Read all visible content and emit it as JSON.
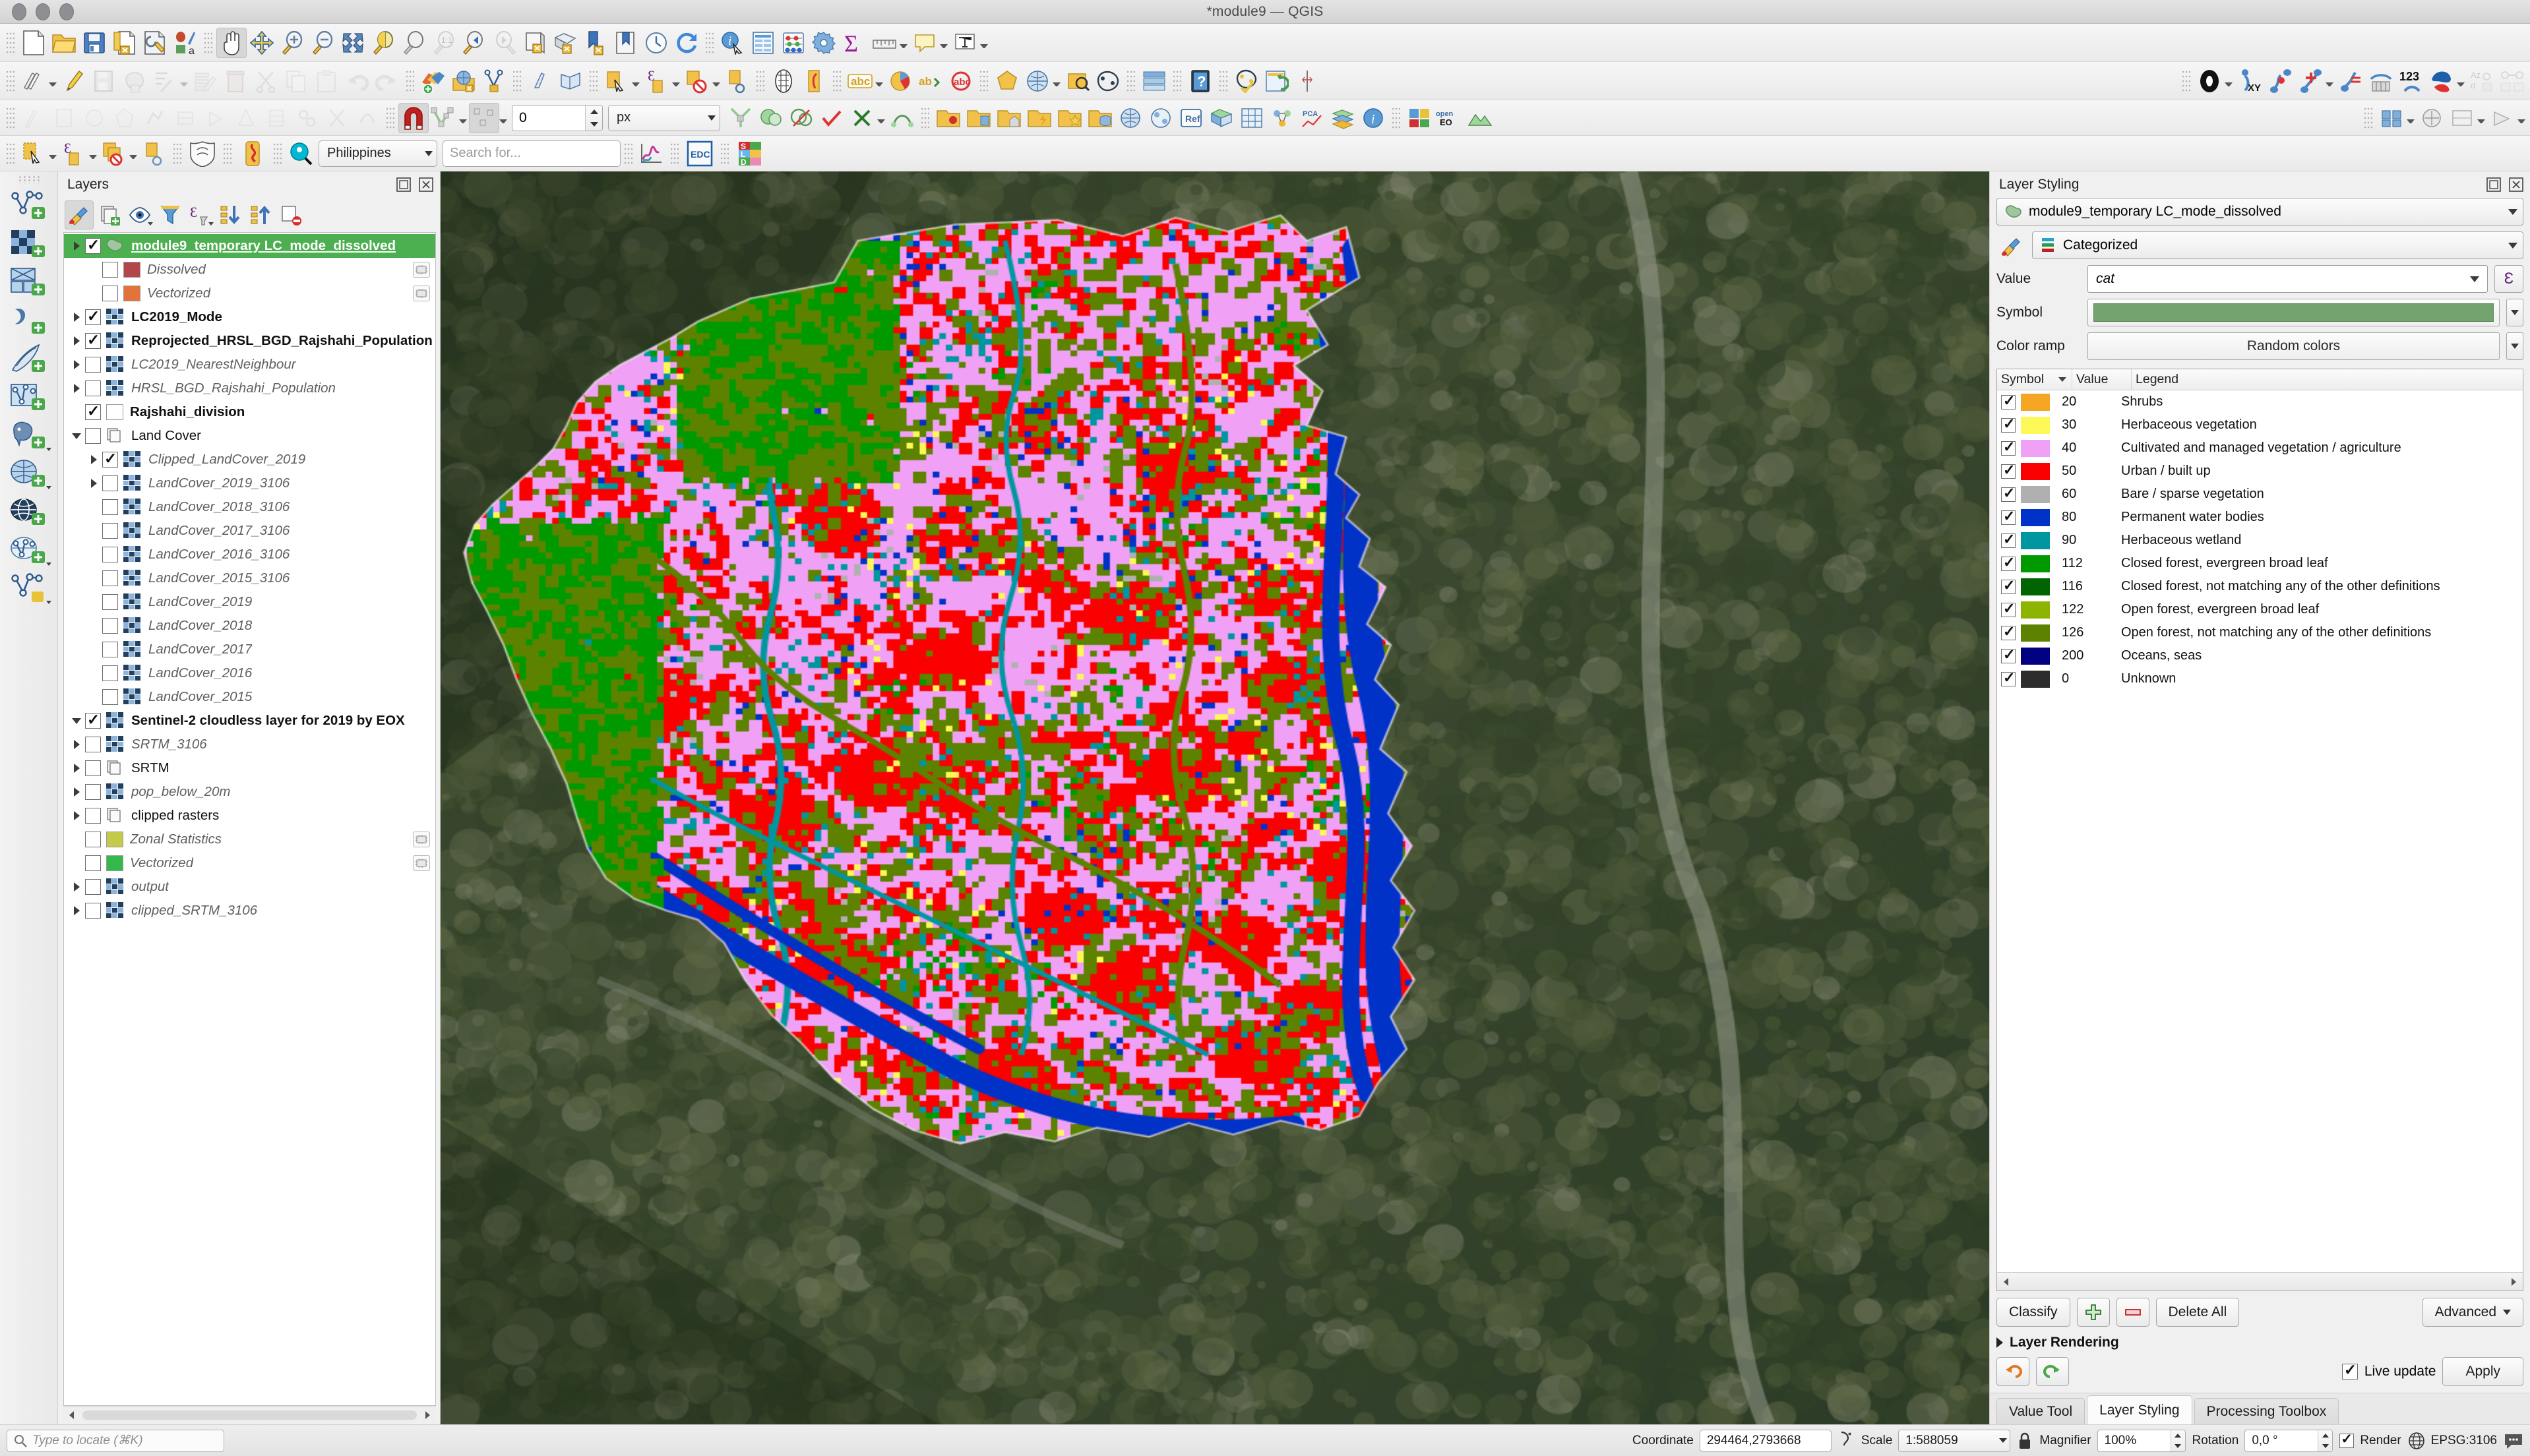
{
  "window": {
    "title": "*module9 — QGIS"
  },
  "toolbars": {
    "row1": [
      {
        "name": "new-project-icon",
        "label": "New Project"
      },
      {
        "name": "open-project-icon",
        "label": "Open Project"
      },
      {
        "name": "save-project-icon",
        "label": "Save Project"
      },
      {
        "name": "new-print-layout-icon",
        "label": "New Print Layout"
      },
      {
        "name": "style-manager-icon",
        "label": "Style Manager"
      },
      {
        "name": "pan-map-icon",
        "label": "Pan Map"
      },
      {
        "name": "pan-to-selection-icon",
        "label": "Pan Map to Selection"
      },
      {
        "name": "zoom-in-icon",
        "label": "Zoom In"
      },
      {
        "name": "zoom-out-icon",
        "label": "Zoom Out"
      },
      {
        "name": "zoom-full-icon",
        "label": "Zoom Full"
      },
      {
        "name": "zoom-selection-icon",
        "label": "Zoom to Selection"
      },
      {
        "name": "zoom-layer-icon",
        "label": "Zoom to Layer"
      },
      {
        "name": "zoom-native-icon",
        "label": "Zoom to Native Resolution"
      },
      {
        "name": "zoom-last-icon",
        "label": "Zoom Last"
      },
      {
        "name": "zoom-next-icon",
        "label": "Zoom Next"
      },
      {
        "name": "new-map-view-icon",
        "label": "New Map View"
      },
      {
        "name": "new-3d-map-view-icon",
        "label": "New 3D Map View"
      },
      {
        "name": "refresh-icon",
        "label": "Refresh"
      },
      {
        "name": "identify-features-icon",
        "label": "Identify Features"
      },
      {
        "name": "attribute-table-icon",
        "label": "Open Attribute Table"
      },
      {
        "name": "field-calculator-icon",
        "label": "Field Calculator"
      },
      {
        "name": "statistics-icon",
        "label": "Statistical Summary"
      },
      {
        "name": "measure-icon",
        "label": "Measure Line"
      },
      {
        "name": "map-tips-icon",
        "label": "Show Map Tips"
      },
      {
        "name": "new-bookmark-icon",
        "label": "New Bookmark"
      },
      {
        "name": "text-annotation-icon",
        "label": "Text Annotation"
      }
    ],
    "row4": {
      "snapping_value": "0",
      "snapping_unit": "px"
    },
    "row5": {
      "region_value": "Philippines",
      "search_placeholder": "Search for...",
      "edc_label": "EDC"
    }
  },
  "layers_panel": {
    "title": "Layers",
    "items": [
      {
        "label": "module9_temporary LC_mode_dissolved",
        "indent": 0,
        "expander": "right",
        "checked": true,
        "icon": "polygon-layer",
        "style": "sel"
      },
      {
        "label": "Dissolved",
        "indent": 1,
        "expander": "none",
        "checked": false,
        "swatch": "#b4464b",
        "style": "italic",
        "chip": true
      },
      {
        "label": "Vectorized",
        "indent": 1,
        "expander": "none",
        "checked": false,
        "swatch": "#e2733a",
        "style": "italic",
        "chip": true
      },
      {
        "label": "LC2019_Mode",
        "indent": 0,
        "expander": "right",
        "checked": true,
        "icon": "raster-layer",
        "style": "bold"
      },
      {
        "label": "Reprojected_HRSL_BGD_Rajshahi_Population",
        "indent": 0,
        "expander": "right",
        "checked": true,
        "icon": "raster-layer",
        "style": "bold"
      },
      {
        "label": "LC2019_NearestNeighbour",
        "indent": 0,
        "expander": "right",
        "checked": false,
        "icon": "raster-layer",
        "style": "italic"
      },
      {
        "label": "HRSL_BGD_Rajshahi_Population",
        "indent": 0,
        "expander": "right",
        "checked": false,
        "icon": "raster-layer",
        "style": "italic"
      },
      {
        "label": "Rajshahi_division",
        "indent": 0,
        "expander": "none",
        "checked": true,
        "swatch": "#ffffff",
        "style": "bold"
      },
      {
        "label": "Land Cover",
        "indent": 0,
        "expander": "down",
        "checked": false,
        "icon": "group",
        "style": "normal"
      },
      {
        "label": "Clipped_LandCover_2019",
        "indent": 1,
        "expander": "right",
        "checked": true,
        "icon": "raster-layer",
        "style": "italic"
      },
      {
        "label": "LandCover_2019_3106",
        "indent": 1,
        "expander": "right",
        "checked": false,
        "icon": "raster-layer",
        "style": "italic"
      },
      {
        "label": "LandCover_2018_3106",
        "indent": 1,
        "expander": "none",
        "checked": false,
        "icon": "raster-layer",
        "style": "italic"
      },
      {
        "label": "LandCover_2017_3106",
        "indent": 1,
        "expander": "none",
        "checked": false,
        "icon": "raster-layer",
        "style": "italic"
      },
      {
        "label": "LandCover_2016_3106",
        "indent": 1,
        "expander": "none",
        "checked": false,
        "icon": "raster-layer",
        "style": "italic"
      },
      {
        "label": "LandCover_2015_3106",
        "indent": 1,
        "expander": "none",
        "checked": false,
        "icon": "raster-layer",
        "style": "italic"
      },
      {
        "label": "LandCover_2019",
        "indent": 1,
        "expander": "none",
        "checked": false,
        "icon": "raster-layer",
        "style": "italic"
      },
      {
        "label": "LandCover_2018",
        "indent": 1,
        "expander": "none",
        "checked": false,
        "icon": "raster-layer",
        "style": "italic"
      },
      {
        "label": "LandCover_2017",
        "indent": 1,
        "expander": "none",
        "checked": false,
        "icon": "raster-layer",
        "style": "italic"
      },
      {
        "label": "LandCover_2016",
        "indent": 1,
        "expander": "none",
        "checked": false,
        "icon": "raster-layer",
        "style": "italic"
      },
      {
        "label": "LandCover_2015",
        "indent": 1,
        "expander": "none",
        "checked": false,
        "icon": "raster-layer",
        "style": "italic"
      },
      {
        "label": "Sentinel-2 cloudless layer for 2019 by EOX",
        "indent": 0,
        "expander": "down",
        "checked": true,
        "icon": "raster-layer",
        "style": "bold"
      },
      {
        "label": "SRTM_3106",
        "indent": 0,
        "expander": "right",
        "checked": false,
        "icon": "raster-layer",
        "style": "italic"
      },
      {
        "label": "SRTM",
        "indent": 0,
        "expander": "right",
        "checked": false,
        "icon": "group",
        "style": "normal"
      },
      {
        "label": "pop_below_20m",
        "indent": 0,
        "expander": "right",
        "checked": false,
        "icon": "raster-layer",
        "style": "italic"
      },
      {
        "label": "clipped rasters",
        "indent": 0,
        "expander": "right",
        "checked": false,
        "icon": "group",
        "style": "normal"
      },
      {
        "label": "Zonal Statistics",
        "indent": 0,
        "expander": "none",
        "checked": false,
        "swatch": "#c4ca4a",
        "style": "italic",
        "chip": true
      },
      {
        "label": "Vectorized",
        "indent": 0,
        "expander": "none",
        "checked": false,
        "swatch": "#33b84a",
        "style": "italic",
        "chip": true
      },
      {
        "label": "output",
        "indent": 0,
        "expander": "right",
        "checked": false,
        "icon": "raster-layer",
        "style": "italic"
      },
      {
        "label": "clipped_SRTM_3106",
        "indent": 0,
        "expander": "right",
        "checked": false,
        "icon": "raster-layer",
        "style": "italic"
      }
    ],
    "toolbar_icons": [
      {
        "name": "open-layer-styling-panel-icon",
        "active": true
      },
      {
        "name": "add-group-icon",
        "active": false
      },
      {
        "name": "manage-map-themes-icon",
        "active": false
      },
      {
        "name": "filter-legend-icon",
        "active": false
      },
      {
        "name": "filter-legend-by-expression-icon",
        "active": false
      },
      {
        "name": "expand-all-icon",
        "active": false
      },
      {
        "name": "collapse-all-icon",
        "active": false
      },
      {
        "name": "remove-layer-icon",
        "active": false
      }
    ]
  },
  "style_panel": {
    "title": "Layer Styling",
    "layer_name": "module9_temporary LC_mode_dissolved",
    "renderer": "Categorized",
    "value_label": "Value",
    "value_field": "cat",
    "symbol_label": "Symbol",
    "symbol_color": "#74a370",
    "colorramp_label": "Color ramp",
    "colorramp_value": "Random colors",
    "table_headers": {
      "symbol": "Symbol",
      "value": "Value",
      "legend": "Legend"
    },
    "categories": [
      {
        "color": "#f5a623",
        "value": "20",
        "legend": "Shrubs",
        "checked": true
      },
      {
        "color": "#fcf858",
        "value": "30",
        "legend": "Herbaceous vegetation",
        "checked": true
      },
      {
        "color": "#f0a0f5",
        "value": "40",
        "legend": "Cultivated and managed vegetation / agriculture",
        "checked": true
      },
      {
        "color": "#fb0000",
        "value": "50",
        "legend": "Urban / built up",
        "checked": true
      },
      {
        "color": "#b0b0b0",
        "value": "60",
        "legend": "Bare / sparse vegetation",
        "checked": true
      },
      {
        "color": "#0032c8",
        "value": "80",
        "legend": "Permanent water bodies",
        "checked": true
      },
      {
        "color": "#0096a0",
        "value": "90",
        "legend": "Herbaceous wetland",
        "checked": true
      },
      {
        "color": "#009a00",
        "value": "112",
        "legend": "Closed forest, evergreen broad leaf",
        "checked": true
      },
      {
        "color": "#006400",
        "value": "116",
        "legend": "Closed forest, not matching any of the other definitions",
        "checked": true
      },
      {
        "color": "#8db400",
        "value": "122",
        "legend": "Open forest, evergreen broad leaf",
        "checked": true
      },
      {
        "color": "#5c8200",
        "value": "126",
        "legend": "Open forest, not matching any of the other definitions",
        "checked": true
      },
      {
        "color": "#000080",
        "value": "200",
        "legend": "Oceans, seas",
        "checked": true
      },
      {
        "color": "#2d2d2d",
        "value": "0",
        "legend": "Unknown",
        "checked": true
      }
    ],
    "buttons": {
      "classify": "Classify",
      "add": "add-category",
      "remove": "remove-category",
      "delete_all": "Delete All",
      "advanced": "Advanced"
    },
    "layer_rendering": "Layer Rendering",
    "live_update": "Live update",
    "apply": "Apply",
    "tabs": [
      {
        "label": "Value Tool",
        "active": false
      },
      {
        "label": "Layer Styling",
        "active": true
      },
      {
        "label": "Processing Toolbox",
        "active": false
      }
    ]
  },
  "statusbar": {
    "locator_placeholder": "Type to locate (⌘K)",
    "coordinate_label": "Coordinate",
    "coordinate_value": "294464,2793668",
    "scale_label": "Scale",
    "scale_value": "1:588059",
    "magnifier_label": "Magnifier",
    "magnifier_value": "100%",
    "rotation_label": "Rotation",
    "rotation_value": "0,0 °",
    "render_label": "Render",
    "crs_label": "EPSG:3106"
  },
  "map": {
    "background_color": "#3a4a30",
    "agriculture_color": "#f0a0f5",
    "urban_color": "#fb0000",
    "water_color": "#0032c8",
    "wetland_color": "#0096a0",
    "forest_color": "#5c8200"
  }
}
